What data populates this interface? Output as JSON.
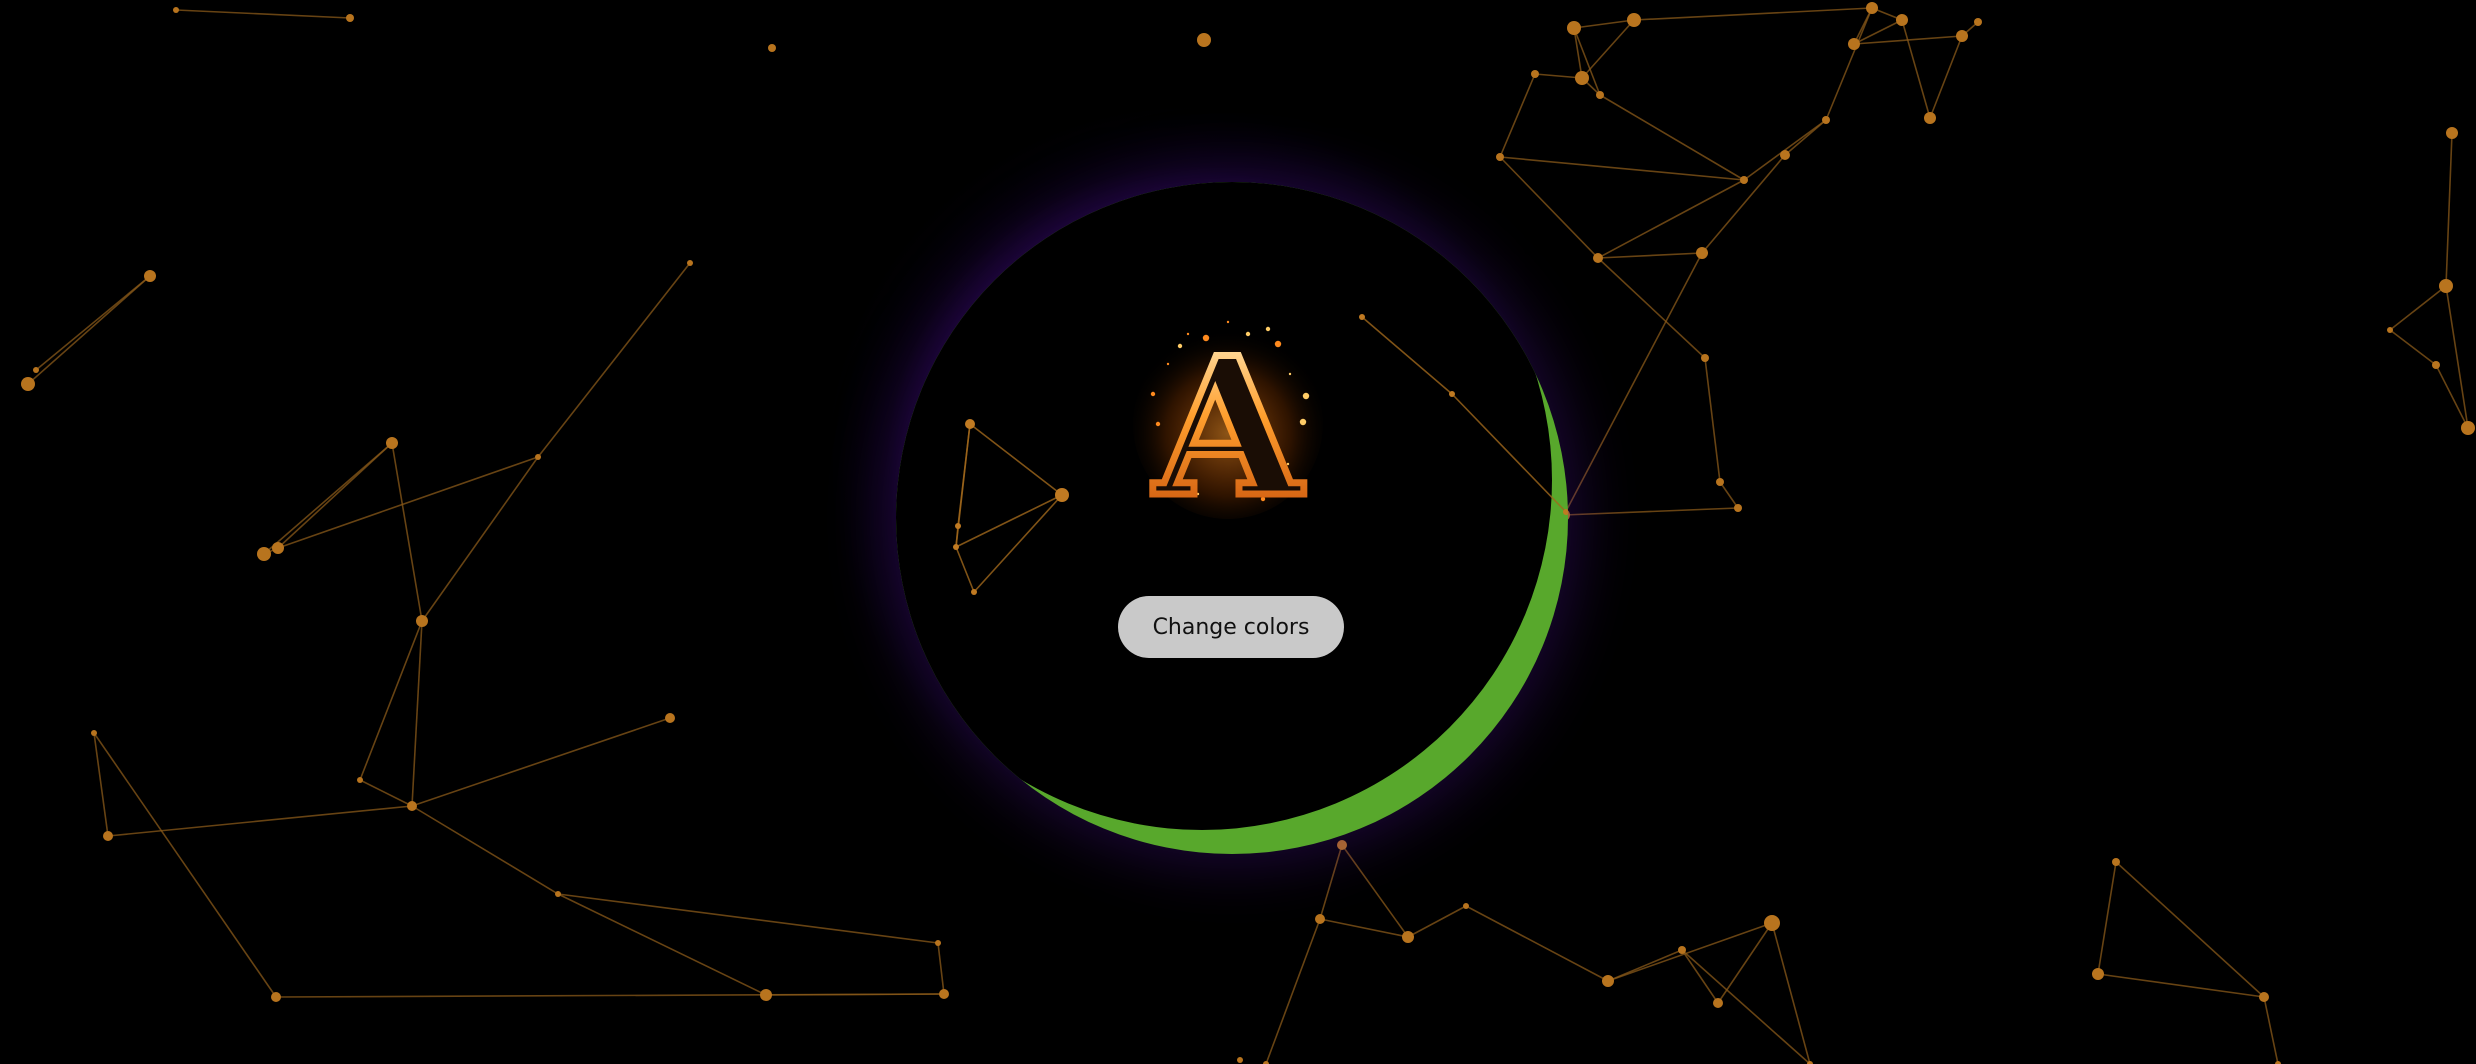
{
  "page": {
    "background_color": "#000000"
  },
  "orb": {
    "rim_color": "#58a82c",
    "glow_color": "#5a14aa"
  },
  "network": {
    "node_color": "#b8741e",
    "line_color": "#8a5a1a"
  },
  "logo": {
    "letter": "A",
    "icon": "flaming-letter-logo",
    "colors": [
      "#ff8a1e",
      "#ffcc66",
      "#ffffff"
    ]
  },
  "controls": {
    "change_colors_label": "Change colors"
  }
}
